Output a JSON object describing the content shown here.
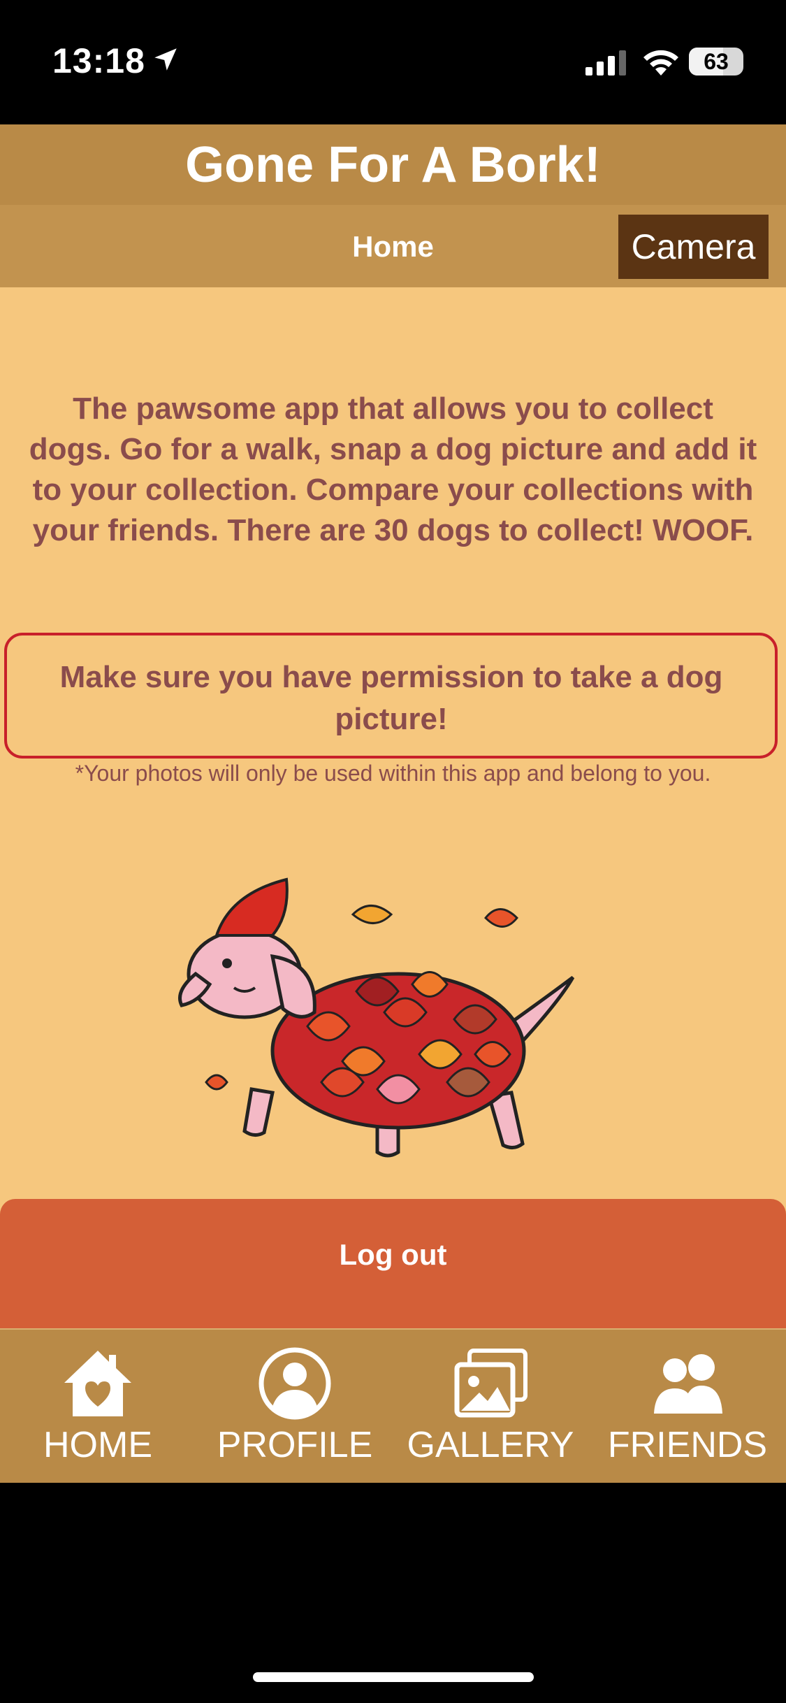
{
  "status_bar": {
    "time": "13:18",
    "battery": "63",
    "battery_level": 0.63
  },
  "app": {
    "title": "Gone For A Bork!",
    "nav": {
      "home": "Home",
      "camera": "Camera"
    },
    "intro": "The pawsome app that allows you to collect dogs. Go for a walk, snap a dog picture and add it to your collection. Compare your collections with your friends. There are 30 dogs to collect! WOOF.",
    "permission_notice": "Make sure you have permission to take a dog picture!",
    "footnote": "*Your photos will only be used within this app and belong to you.",
    "logout_label": "Log out"
  },
  "tabs": [
    {
      "label": "HOME",
      "icon": "home-icon"
    },
    {
      "label": "PROFILE",
      "icon": "profile-icon"
    },
    {
      "label": "GALLERY",
      "icon": "gallery-icon"
    },
    {
      "label": "FRIENDS",
      "icon": "friends-icon"
    }
  ],
  "colors": {
    "background": "#F6C77E",
    "header": "#B98A47",
    "camera_button": "#5B3413",
    "logout": "#D45F37",
    "text": "#8A4C4C",
    "notice_border": "#C8202A"
  }
}
